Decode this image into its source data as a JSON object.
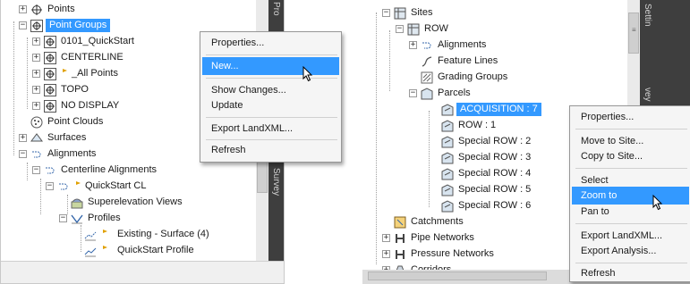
{
  "left": {
    "rows": [
      {
        "label": "Points"
      },
      {
        "label": "Point Groups"
      },
      {
        "label": "0101_QuickStart"
      },
      {
        "label": "CENTERLINE"
      },
      {
        "label": "_All Points"
      },
      {
        "label": "TOPO"
      },
      {
        "label": "NO DISPLAY"
      },
      {
        "label": "Point Clouds"
      },
      {
        "label": "Surfaces"
      },
      {
        "label": "Alignments"
      },
      {
        "label": "Centerline Alignments"
      },
      {
        "label": "QuickStart CL"
      },
      {
        "label": "Superelevation Views"
      },
      {
        "label": "Profiles"
      },
      {
        "label": "Existing - Surface (4)"
      },
      {
        "label": "QuickStart Profile"
      }
    ],
    "side_tabs": [
      "Pro",
      "Survey"
    ],
    "menu": {
      "items": [
        "Properties...",
        "New...",
        "Show Changes...",
        "Update",
        "Export LandXML...",
        "Refresh"
      ],
      "highlighted": "New..."
    }
  },
  "right": {
    "rows": [
      {
        "label": "Sites"
      },
      {
        "label": "ROW"
      },
      {
        "label": "Alignments"
      },
      {
        "label": "Feature Lines"
      },
      {
        "label": "Grading Groups"
      },
      {
        "label": "Parcels"
      },
      {
        "label": "ACQUISITION : 7"
      },
      {
        "label": "ROW : 1"
      },
      {
        "label": "Special ROW : 2"
      },
      {
        "label": "Special ROW : 3"
      },
      {
        "label": "Special ROW : 4"
      },
      {
        "label": "Special ROW : 5"
      },
      {
        "label": "Special ROW : 6"
      },
      {
        "label": "Catchments"
      },
      {
        "label": "Pipe Networks"
      },
      {
        "label": "Pressure Networks"
      },
      {
        "label": "Corridors"
      }
    ],
    "side_tabs": [
      "Settin",
      "vey"
    ],
    "menu": {
      "items": [
        "Properties...",
        "Move to Site...",
        "Copy to Site...",
        "Select",
        "Zoom to",
        "Pan to",
        "Export LandXML...",
        "Export Analysis...",
        "Refresh"
      ],
      "highlighted": "Zoom to"
    }
  },
  "colors": {
    "selection": "#3399ff",
    "menu_bg": "#f5f5f5",
    "strip": "#3e3e3e"
  }
}
